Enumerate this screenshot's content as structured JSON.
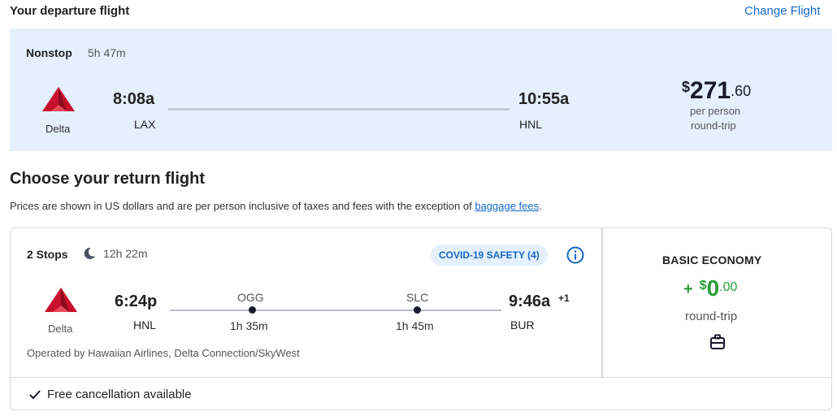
{
  "header": {
    "title": "Your departure flight",
    "change_link": "Change Flight"
  },
  "departure": {
    "stops": "Nonstop",
    "duration": "5h 47m",
    "airline": "Delta",
    "depart_time": "8:08a",
    "depart_airport": "LAX",
    "arrive_time": "10:55a",
    "arrive_airport": "HNL",
    "price": {
      "currency": "$",
      "dollars": "271",
      "cents": ".60",
      "per_person": "per person",
      "trip_type": "round-trip"
    }
  },
  "return_section": {
    "title": "Choose your return flight",
    "note_prefix": "Prices are shown in US dollars and are per person inclusive of taxes and fees with the exception of ",
    "note_link": "baggage fees",
    "note_suffix": "."
  },
  "return_flight": {
    "stops": "2 Stops",
    "duration": "12h 22m",
    "covid_badge": "COVID-19 SAFETY (4)",
    "airline": "Delta",
    "depart_time": "6:24p",
    "depart_airport": "HNL",
    "stops_list": [
      {
        "code": "OGG",
        "layover": "1h 35m"
      },
      {
        "code": "SLC",
        "layover": "1h 45m"
      }
    ],
    "arrive_time": "9:46a",
    "day_offset": "+1",
    "arrive_airport": "BUR",
    "operated_by": "Operated by Hawaiian Airlines, Delta Connection/SkyWest",
    "fare": {
      "name": "BASIC ECONOMY",
      "plus": "+",
      "currency": "$",
      "dollars": "0",
      "cents": ".00",
      "trip_type": "round-trip"
    },
    "cancellation": "Free cancellation available"
  },
  "colors": {
    "accent": "#1668c8",
    "panel_bg": "#e4f0fd",
    "price_green": "#2a9d3a",
    "delta_red": "#c8102e"
  },
  "icons": [
    "delta-logo-icon",
    "moon-icon",
    "info-icon",
    "suitcase-icon",
    "check-icon"
  ]
}
